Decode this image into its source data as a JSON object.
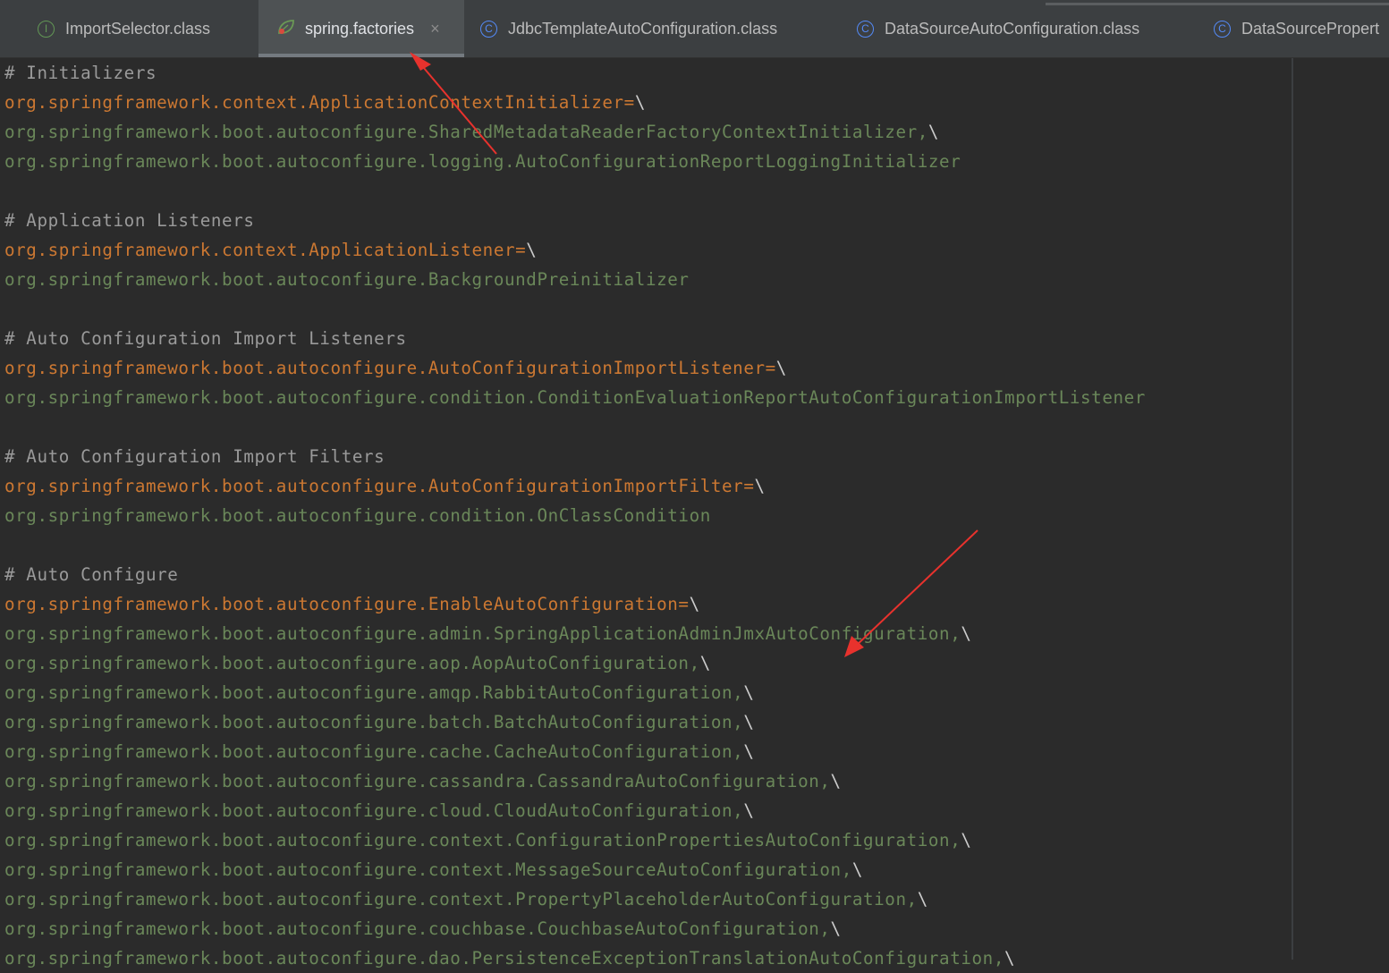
{
  "tabs": [
    {
      "label": "ImportSelector.class",
      "icon": "interface-icon",
      "glyph": "I"
    },
    {
      "label": "spring.factories",
      "icon": "spring-leaf-icon",
      "active": true,
      "close": "×"
    },
    {
      "label": "JdbcTemplateAutoConfiguration.class",
      "icon": "class-icon",
      "glyph": "C"
    },
    {
      "label": "DataSourceAutoConfiguration.class",
      "icon": "class-icon",
      "glyph": "C"
    },
    {
      "label": "DataSourcePropert",
      "icon": "class-icon",
      "glyph": "C"
    }
  ],
  "colors": {
    "background": "#2b2b2b",
    "comment": "#9a9a9a",
    "property_key": "#cc7832",
    "property_value": "#6a8759",
    "annotation_arrow": "#e8322d"
  },
  "code_lines": [
    {
      "type": "comment",
      "text": "# Initializers"
    },
    {
      "type": "key",
      "text": "org.springframework.context.ApplicationContextInitializer",
      "suffix": "=\\"
    },
    {
      "type": "val",
      "text": "org.springframework.boot.autoconfigure.SharedMetadataReaderFactoryContextInitializer,",
      "suffix": "\\"
    },
    {
      "type": "val",
      "text": "org.springframework.boot.autoconfigure.logging.AutoConfigurationReportLoggingInitializer",
      "suffix": ""
    },
    {
      "type": "blank",
      "text": ""
    },
    {
      "type": "comment",
      "text": "# Application Listeners"
    },
    {
      "type": "key",
      "text": "org.springframework.context.ApplicationListener",
      "suffix": "=\\"
    },
    {
      "type": "val",
      "text": "org.springframework.boot.autoconfigure.BackgroundPreinitializer",
      "suffix": ""
    },
    {
      "type": "blank",
      "text": ""
    },
    {
      "type": "comment",
      "text": "# Auto Configuration Import Listeners"
    },
    {
      "type": "key",
      "text": "org.springframework.boot.autoconfigure.AutoConfigurationImportListener",
      "suffix": "=\\"
    },
    {
      "type": "val",
      "text": "org.springframework.boot.autoconfigure.condition.ConditionEvaluationReportAutoConfigurationImportListener",
      "suffix": ""
    },
    {
      "type": "blank",
      "text": ""
    },
    {
      "type": "comment",
      "text": "# Auto Configuration Import Filters"
    },
    {
      "type": "key",
      "text": "org.springframework.boot.autoconfigure.AutoConfigurationImportFilter",
      "suffix": "=\\"
    },
    {
      "type": "val",
      "text": "org.springframework.boot.autoconfigure.condition.OnClassCondition",
      "suffix": ""
    },
    {
      "type": "blank",
      "text": ""
    },
    {
      "type": "comment",
      "text": "# Auto Configure"
    },
    {
      "type": "key",
      "text": "org.springframework.boot.autoconfigure.EnableAutoConfiguration",
      "suffix": "=\\"
    },
    {
      "type": "val",
      "text": "org.springframework.boot.autoconfigure.admin.SpringApplicationAdminJmxAutoConfiguration,",
      "suffix": "\\"
    },
    {
      "type": "val",
      "text": "org.springframework.boot.autoconfigure.aop.AopAutoConfiguration,",
      "suffix": "\\"
    },
    {
      "type": "val",
      "text": "org.springframework.boot.autoconfigure.amqp.RabbitAutoConfiguration,",
      "suffix": "\\"
    },
    {
      "type": "val",
      "text": "org.springframework.boot.autoconfigure.batch.BatchAutoConfiguration,",
      "suffix": "\\"
    },
    {
      "type": "val",
      "text": "org.springframework.boot.autoconfigure.cache.CacheAutoConfiguration,",
      "suffix": "\\"
    },
    {
      "type": "val",
      "text": "org.springframework.boot.autoconfigure.cassandra.CassandraAutoConfiguration,",
      "suffix": "\\"
    },
    {
      "type": "val",
      "text": "org.springframework.boot.autoconfigure.cloud.CloudAutoConfiguration,",
      "suffix": "\\"
    },
    {
      "type": "val",
      "text": "org.springframework.boot.autoconfigure.context.ConfigurationPropertiesAutoConfiguration,",
      "suffix": "\\"
    },
    {
      "type": "val",
      "text": "org.springframework.boot.autoconfigure.context.MessageSourceAutoConfiguration,",
      "suffix": "\\"
    },
    {
      "type": "val",
      "text": "org.springframework.boot.autoconfigure.context.PropertyPlaceholderAutoConfiguration,",
      "suffix": "\\"
    },
    {
      "type": "val",
      "text": "org.springframework.boot.autoconfigure.couchbase.CouchbaseAutoConfiguration,",
      "suffix": "\\"
    },
    {
      "type": "val",
      "text": "org.springframework.boot.autoconfigure.dao.PersistenceExceptionTranslationAutoConfiguration,",
      "suffix": "\\"
    }
  ]
}
